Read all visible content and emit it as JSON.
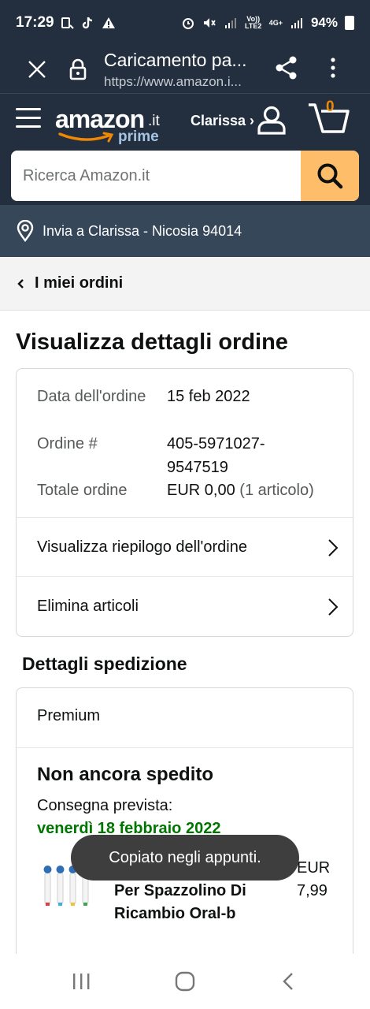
{
  "status_bar": {
    "time": "17:29",
    "battery": "94%",
    "network_label_1": "Vo)) LTE2",
    "network_label_2": "4G+"
  },
  "browser": {
    "title": "Caricamento pa...",
    "url": "https://www.amazon.i..."
  },
  "header": {
    "logo_word": "amazon",
    "logo_tld": ".it",
    "logo_prime": "prime",
    "account_label": "Clarissa ›",
    "cart_count": "0",
    "search_placeholder": "Ricerca Amazon.it",
    "accent_color": "#febd69"
  },
  "deliver": {
    "text": "Invia a Clarissa - Nicosia 94014"
  },
  "back": {
    "label": "I miei ordini"
  },
  "page": {
    "title": "Visualizza dettagli ordine"
  },
  "order": {
    "date_label": "Data dell'ordine",
    "date_value": "15 feb 2022",
    "number_label": "Ordine #",
    "number_value": "405-5971027-9547519",
    "total_label": "Totale ordine",
    "total_value": "EUR 0,00",
    "total_items": "(1 articolo)"
  },
  "links": {
    "summary": "Visualizza riepilogo dell'ordine",
    "delete": "Elimina articoli"
  },
  "shipping": {
    "section_title": "Dettagli spedizione",
    "speed": "Premium",
    "status": "Non ancora spedito",
    "estimate_label": "Consegna prevista:",
    "estimate_date": "venerdì 18 febbraio 2022",
    "estimate_color": "#007600"
  },
  "product": {
    "title": "Kaleiya Testine Per Spazzolino Di Ricambio Oral-b",
    "price": "EUR 7,99"
  },
  "toast": {
    "text": "Copiato negli appunti."
  }
}
